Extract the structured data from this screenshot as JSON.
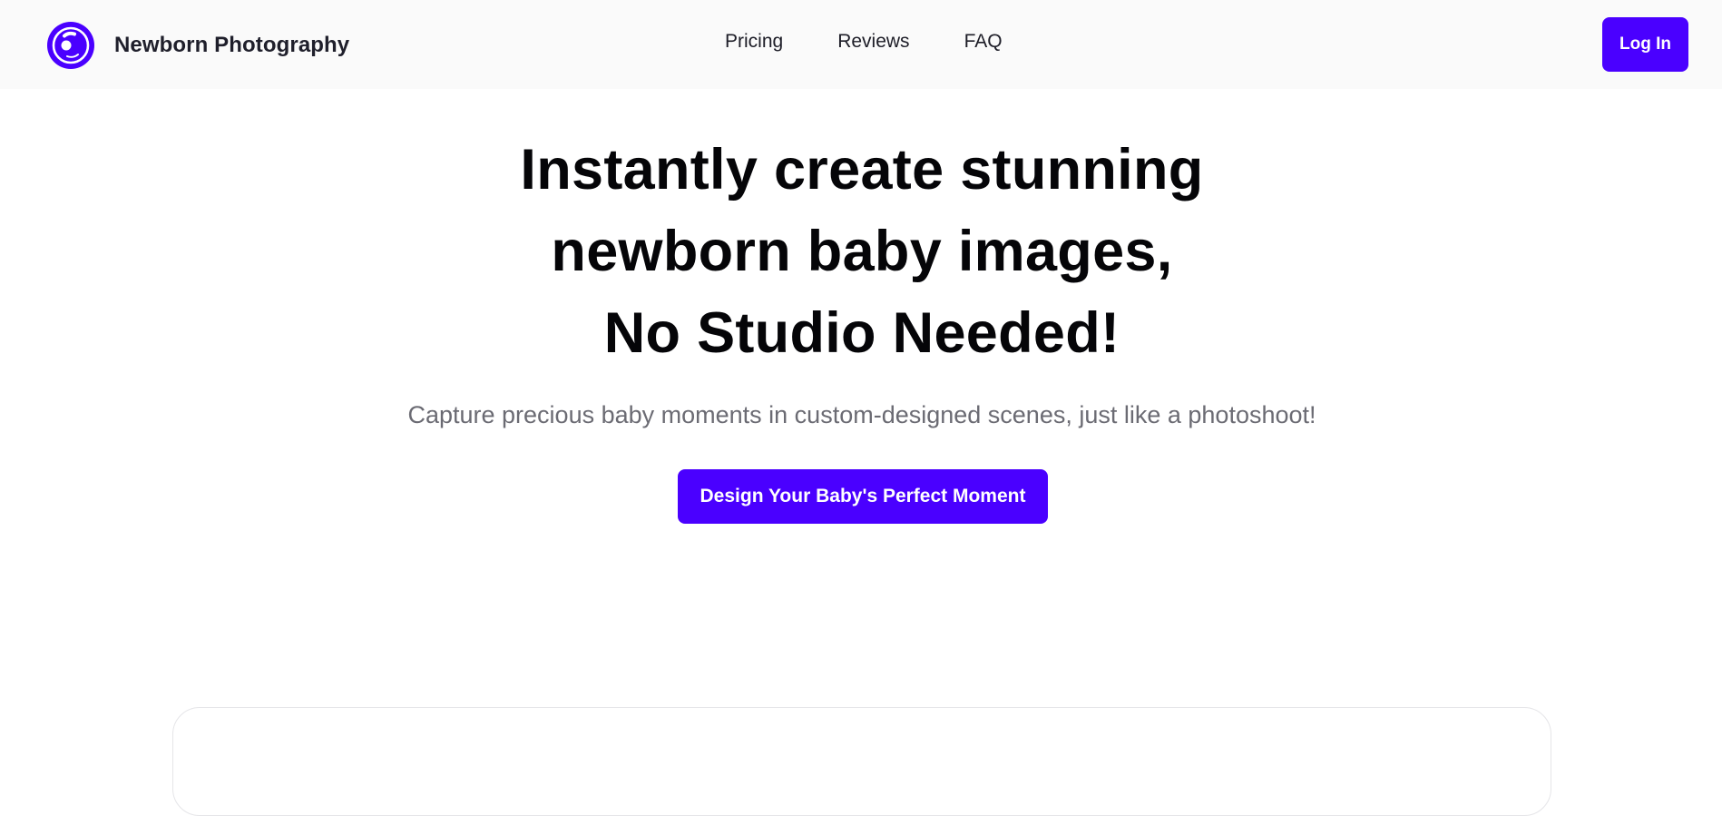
{
  "header": {
    "brand_name": "Newborn Photography",
    "logo_icon": "camera-lens-icon",
    "nav": [
      {
        "label": "Pricing"
      },
      {
        "label": "Reviews"
      },
      {
        "label": "FAQ"
      }
    ],
    "login_label": "Log In"
  },
  "hero": {
    "title_lines": [
      "Instantly create stunning",
      "newborn baby images,",
      "No Studio Needed!"
    ],
    "subtitle": "Capture precious baby moments in custom-designed scenes, just like a photoshoot!",
    "cta_label": "Design Your Baby's Perfect Moment"
  },
  "colors": {
    "accent": "#4a00ff",
    "header_bg": "#fafafa",
    "subtitle": "#6b6b73"
  }
}
